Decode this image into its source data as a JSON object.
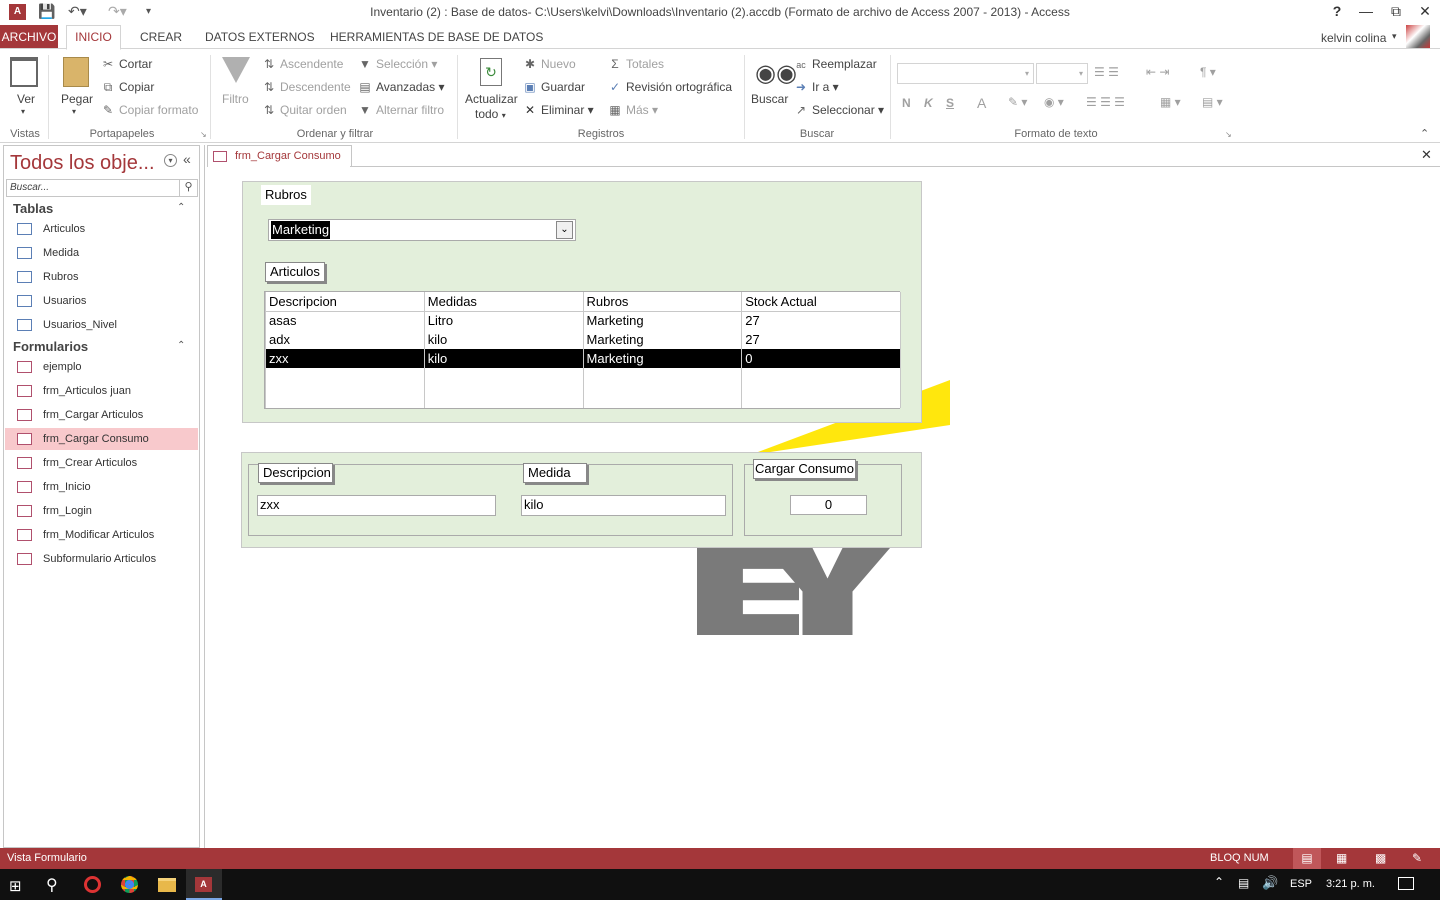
{
  "window": {
    "title": "Inventario (2) : Base de datos- C:\\Users\\kelvi\\Downloads\\Inventario (2).accdb (Formato de archivo de Access 2007 - 2013) - Access",
    "help": "?",
    "user": "kelvin colina"
  },
  "tabs": [
    "ARCHIVO",
    "INICIO",
    "CREAR",
    "DATOS EXTERNOS",
    "HERRAMIENTAS DE BASE DE DATOS"
  ],
  "ribbon": {
    "vistas": {
      "ver": "Ver",
      "group": "Vistas"
    },
    "portapapeles": {
      "pegar": "Pegar",
      "cortar": "Cortar",
      "copiar": "Copiar",
      "copiar_formato": "Copiar formato",
      "group": "Portapapeles"
    },
    "ordenar": {
      "filtro": "Filtro",
      "ascendente": "Ascendente",
      "descendente": "Descendente",
      "quitar_orden": "Quitar orden",
      "seleccion": "Selección",
      "avanzadas": "Avanzadas",
      "alternar_filtro": "Alternar filtro",
      "group": "Ordenar y filtrar"
    },
    "registros": {
      "actualizar": "Actualizar",
      "todo": "todo",
      "nuevo": "Nuevo",
      "guardar": "Guardar",
      "eliminar": "Eliminar",
      "totales": "Totales",
      "revision": "Revisión ortográfica",
      "mas": "Más",
      "group": "Registros"
    },
    "buscar": {
      "buscar": "Buscar",
      "reemplazar": "Reemplazar",
      "ir_a": "Ir a",
      "seleccionar": "Seleccionar",
      "group": "Buscar"
    },
    "formato": {
      "n": "N",
      "k": "K",
      "s": "S",
      "a": "A",
      "group": "Formato de texto"
    }
  },
  "nav": {
    "title": "Todos los obje...",
    "search_placeholder": "Buscar...",
    "tablas_header": "Tablas",
    "tablas": [
      "Articulos",
      "Medida",
      "Rubros",
      "Usuarios",
      "Usuarios_Nivel"
    ],
    "formularios_header": "Formularios",
    "formularios": [
      "ejemplo",
      "frm_Articulos juan",
      "frm_Cargar Articulos",
      "frm_Cargar Consumo",
      "frm_Crear Articulos",
      "frm_Inicio",
      "frm_Login",
      "frm_Modificar Articulos",
      "Subformulario Articulos"
    ],
    "selected": "frm_Cargar Consumo"
  },
  "document": {
    "tab_label": "frm_Cargar Consumo",
    "rubros_label": "Rubros",
    "rubros_value": "Marketing",
    "articulos_label": "Articulos",
    "grid_headers": [
      "Descripcion",
      "Medidas",
      "Rubros",
      "Stock Actual"
    ],
    "grid_rows": [
      [
        "asas",
        "Litro",
        "Marketing",
        "27"
      ],
      [
        "adx",
        "kilo",
        "Marketing",
        "27"
      ],
      [
        "zxx",
        "kilo",
        "Marketing",
        "0"
      ]
    ],
    "selected_row": 2,
    "descripcion_label": "Descripcion",
    "descripcion_value": "zxx",
    "medida_label": "Medida",
    "medida_value": "kilo",
    "cargar_label": "Cargar Consumo",
    "cargar_value": "0"
  },
  "status": {
    "left": "Vista Formulario",
    "right": "BLOQ NUM"
  },
  "taskbar": {
    "lang": "ESP",
    "time": "3:21 p. m."
  },
  "colors": {
    "accent": "#a4373a",
    "form_bg": "#e3efdb",
    "nav_selected": "#f8c9cc"
  }
}
